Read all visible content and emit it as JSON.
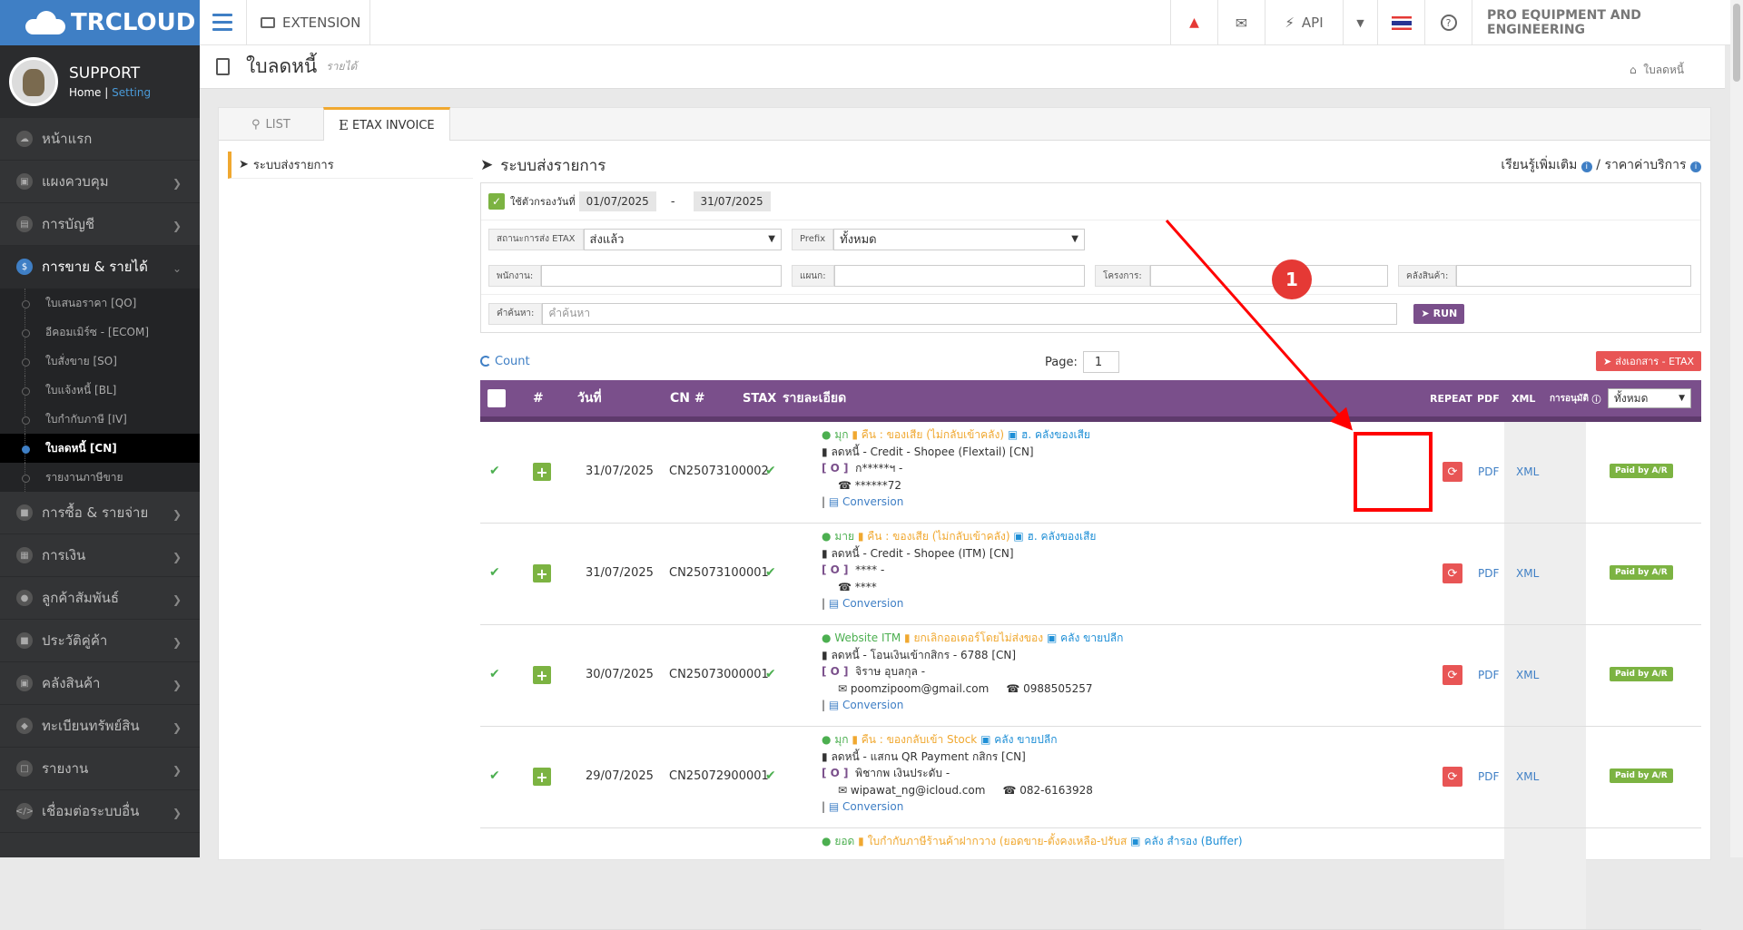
{
  "topbar": {
    "logo": "TRCLOUD",
    "extension": "EXTENSION",
    "api": "API",
    "company": "PRO EQUIPMENT AND ENGINEERING"
  },
  "sidebar": {
    "profile": {
      "name": "SUPPORT",
      "home": "Home",
      "setting": "Setting"
    },
    "items": [
      {
        "label": "หน้าแรก"
      },
      {
        "label": "แผงควบคุม"
      },
      {
        "label": "การบัญชี"
      },
      {
        "label": "การขาย & รายได้"
      },
      {
        "label": "การซื้อ & รายจ่าย"
      },
      {
        "label": "การเงิน"
      },
      {
        "label": "ลูกค้าสัมพันธ์"
      },
      {
        "label": "ประวัติคู่ค้า"
      },
      {
        "label": "คลังสินค้า"
      },
      {
        "label": "ทะเบียนทรัพย์สิน"
      },
      {
        "label": "รายงาน"
      },
      {
        "label": "เชื่อมต่อระบบอื่น"
      }
    ],
    "sub": [
      {
        "label": "ใบเสนอราคา [QO]"
      },
      {
        "label": "อีคอมเมิร์ซ - [ECOM]"
      },
      {
        "label": "ใบสั่งขาย [SO]"
      },
      {
        "label": "ใบแจ้งหนี้ [BL]"
      },
      {
        "label": "ใบกำกับภาษี [IV]"
      },
      {
        "label": "ใบลดหนี้ [CN]"
      },
      {
        "label": "รายงานภาษีขาย"
      }
    ]
  },
  "page": {
    "title": "ใบลดหนี้",
    "subtitle": "รายได้",
    "breadcrumb": "ใบลดหนี้"
  },
  "tabs": {
    "list": "LIST",
    "etax": "ETAX INVOICE"
  },
  "leftnav": {
    "item": "ระบบส่งรายการ"
  },
  "content": {
    "title": "ระบบส่งรายการ",
    "learn": "เรียนรู้เพิ่มเติม",
    "sep": "/",
    "price": "ราคาค่าบริการ"
  },
  "filters": {
    "date_label": "ใช้ตัวกรองวันที่",
    "date_from": "01/07/2025",
    "date_dash": "-",
    "date_to": "31/07/2025",
    "status_label": "สถานะการส่ง ETAX",
    "status_value": "ส่งแล้ว",
    "prefix_label": "Prefix",
    "prefix_value": "ทั้งหมด",
    "employee_label": "พนักงาน:",
    "dept_label": "แผนก:",
    "project_label": "โครงการ:",
    "warehouse_label": "คลังสินค้า:",
    "search_label": "คำค้นหา:",
    "search_placeholder": "คำค้นหา",
    "run": "RUN"
  },
  "tablebar": {
    "count": "Count",
    "page_label": "Page:",
    "page_value": "1",
    "etax_btn": "ส่งเอกสาร - ETAX"
  },
  "table": {
    "headers": {
      "num": "#",
      "date": "วันที่",
      "cn": "CN #",
      "stax": "STAX",
      "detail": "รายละเอียด",
      "repeat": "REPEAT",
      "pdf": "PDF",
      "xml": "XML",
      "approve": "การอนุมัติ",
      "filter": "ทั้งหมด"
    },
    "rows": [
      {
        "date": "31/07/2025",
        "cn": "CN25073100002",
        "l1a": "มุก",
        "l1b": "คืน : ของเสีย (ไม่กลับเข้าคลัง)",
        "l1c": "ฮ. คลังของเสีย",
        "l2": "ลดหนี้ - Credit - Shopee (Flextail) [CN]",
        "l3": "ก*****ฯ -",
        "l4": "******72",
        "conv": "Conversion",
        "pdf": "PDF",
        "xml": "XML",
        "status": "Paid by A/R"
      },
      {
        "date": "31/07/2025",
        "cn": "CN25073100001",
        "l1a": "มาย",
        "l1b": "คืน : ของเสีย (ไม่กลับเข้าคลัง)",
        "l1c": "ฮ. คลังของเสีย",
        "l2": "ลดหนี้ - Credit - Shopee (ITM) [CN]",
        "l3": "**** -",
        "l4": "****",
        "conv": "Conversion",
        "pdf": "PDF",
        "xml": "XML",
        "status": "Paid by A/R"
      },
      {
        "date": "30/07/2025",
        "cn": "CN25073000001",
        "l1a": "Website ITM",
        "l1b": "ยกเลิกออเดอร์โดยไม่ส่งของ",
        "l1c": "คลัง ขายปลีก",
        "l2": "ลดหนี้ - โอนเงินเข้ากสิกร - 6788 [CN]",
        "l3": "จิราษ อุบลกุล -",
        "l4email": "poomzipoom@gmail.com",
        "l4phone": "0988505257",
        "conv": "Conversion",
        "pdf": "PDF",
        "xml": "XML",
        "status": "Paid by A/R"
      },
      {
        "date": "29/07/2025",
        "cn": "CN25072900001",
        "l1a": "มุก",
        "l1b": "คืน : ของกลับเข้า Stock",
        "l1c": "คลัง ขายปลีก",
        "l2": "ลดหนี้ - แสกน QR Payment กสิกร [CN]",
        "l3": "พิชากพ เงินประดับ -",
        "l4email": "wipawat_ng@icloud.com",
        "l4phone": "082-6163928",
        "conv": "Conversion",
        "pdf": "PDF",
        "xml": "XML",
        "status": "Paid by A/R"
      },
      {
        "l1a": "ยอด",
        "l1b": "ใบกำกับภาษีร้านค้าฝากวาง (ยอดขาย-ตั้งคงเหลือ-ปรับส",
        "l1c": "คลัง สำรอง (Buffer)"
      }
    ]
  },
  "annotation": {
    "marker": "1"
  }
}
